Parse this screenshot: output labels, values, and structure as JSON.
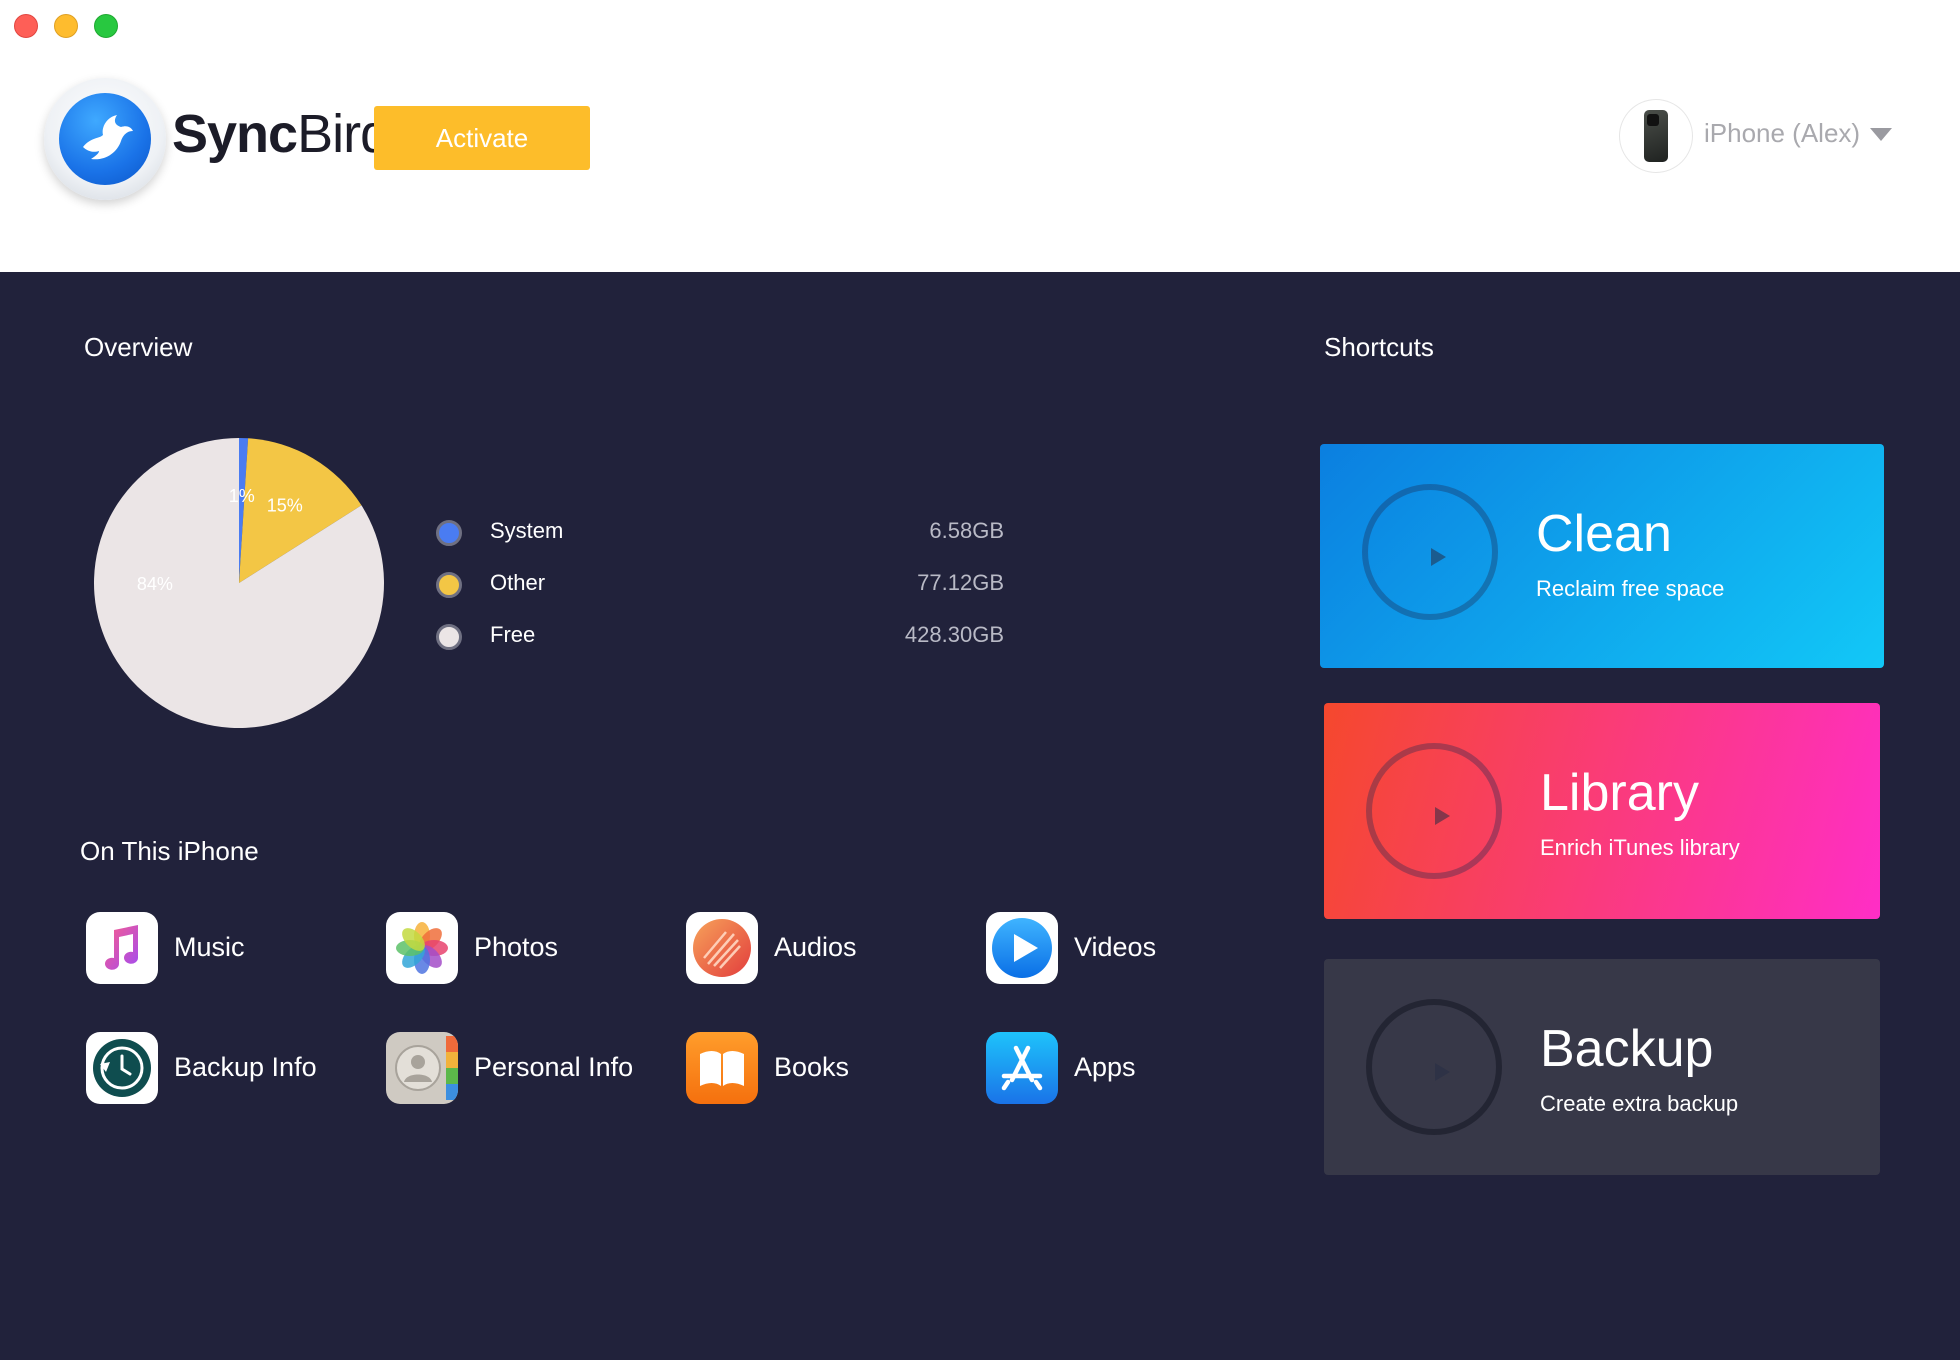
{
  "app": {
    "brand_bold": "Sync",
    "brand_light": "Bird",
    "activate_label": "Activate",
    "device_name": "iPhone (Alex)"
  },
  "overview": {
    "title": "Overview",
    "legend": [
      {
        "label": "System",
        "value": "6.58GB",
        "color": "#4a7cf2"
      },
      {
        "label": "Other",
        "value": "77.12GB",
        "color": "#f3c645"
      },
      {
        "label": "Free",
        "value": "428.30GB",
        "color": "#ebe5e6"
      }
    ],
    "pie_slices": [
      {
        "name": "System",
        "percent": 1,
        "label": "1%",
        "color": "#4a7cf2"
      },
      {
        "name": "Other",
        "percent": 15,
        "label": "15%",
        "color": "#f3c645"
      },
      {
        "name": "Free",
        "percent": 84,
        "label": "84%",
        "color": "#ebe5e6"
      }
    ]
  },
  "on_this_iphone": {
    "title": "On This iPhone",
    "items": [
      {
        "label": "Music"
      },
      {
        "label": "Photos"
      },
      {
        "label": "Audios"
      },
      {
        "label": "Videos"
      },
      {
        "label": "Backup Info"
      },
      {
        "label": "Personal Info"
      },
      {
        "label": "Books"
      },
      {
        "label": "Apps"
      }
    ]
  },
  "shortcuts": {
    "title": "Shortcuts",
    "items": [
      {
        "title": "Clean",
        "subtitle": "Reclaim free space",
        "color_start": "#0b7fe0",
        "color_end": "#12c8f7"
      },
      {
        "title": "Library",
        "subtitle": "Enrich iTunes library",
        "color_start": "#f5482d",
        "color_end": "#ff2ec6"
      },
      {
        "title": "Backup",
        "subtitle": "Create extra backup",
        "color_start": "#373848",
        "color_end": "#373848"
      }
    ]
  }
}
